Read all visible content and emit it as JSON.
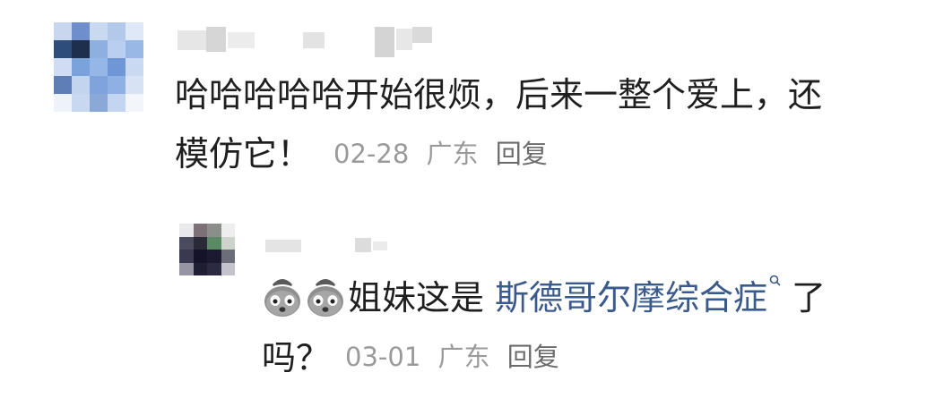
{
  "comments": [
    {
      "text": "哈哈哈哈哈开始很烦，后来一整个爱上，还",
      "text_line2": "模仿它！",
      "date": "02-28",
      "location": "广东",
      "reply_label": "回复"
    }
  ],
  "reply": {
    "text_prefix": "姐妹这是",
    "link_text": "斯德哥尔摩综合症",
    "text_suffix": "了",
    "text_line2": "吗？",
    "date": "03-01",
    "location": "广东",
    "reply_label": "回复",
    "emoji": "sob-emoji"
  }
}
